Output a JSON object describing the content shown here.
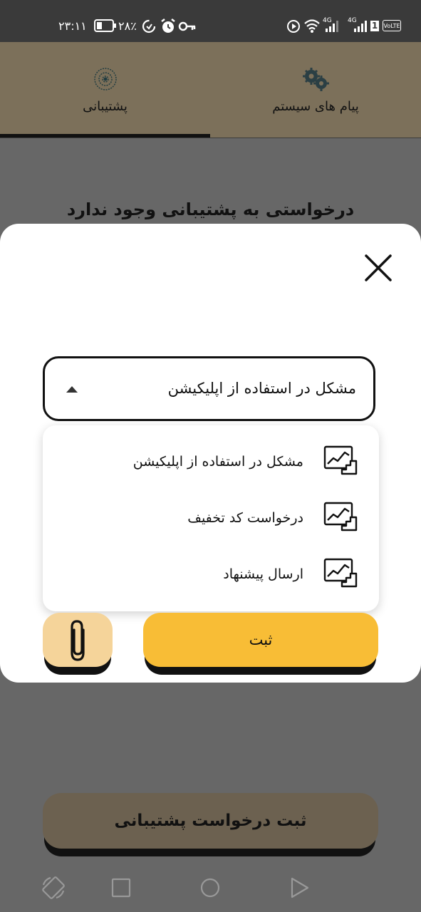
{
  "status_bar": {
    "time": "۲۳:۱۱",
    "battery": "۲۸٪",
    "lte_label": "VoLTE",
    "network_label": "4G",
    "sim_label": "1"
  },
  "tabs": [
    {
      "label": "پشتیبانی",
      "icon": "support-gears-icon",
      "active": true
    },
    {
      "label": "پیام های سیستم",
      "icon": "gears-icon",
      "active": false
    }
  ],
  "empty_state": {
    "text": "درخواستی به پشتیبانی وجود ندارد"
  },
  "form": {
    "selected_value": "مشکل در استفاده از اپلیکیشن",
    "options": [
      {
        "label": "مشکل در استفاده از اپلیکیشن",
        "icon": "stairs-chart-icon"
      },
      {
        "label": "درخواست کد تخفیف",
        "icon": "stairs-chart-icon"
      },
      {
        "label": "ارسال پیشنهاد",
        "icon": "stairs-chart-icon"
      }
    ],
    "submit_label": "ثبت",
    "attach_icon": "paperclip-icon"
  },
  "bottom_button": {
    "label": "ثبت درخواست پشتیبانی"
  },
  "colors": {
    "tab_bar": "#7c705a",
    "submit": "#f8bd36",
    "attach": "#f5d49a",
    "bottom_button": "#6c6150",
    "overlay": "#676767"
  }
}
